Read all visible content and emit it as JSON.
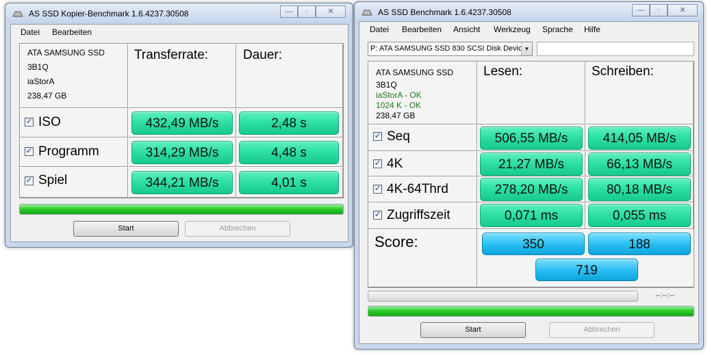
{
  "copy_window": {
    "title": "AS SSD Kopier-Benchmark 1.6.4237.30508",
    "menu": [
      "Datei",
      "Bearbeiten"
    ],
    "drive": {
      "model": "ATA SAMSUNG SSD",
      "firmware": "3B1Q",
      "driver": "iaStorA",
      "size": "238,47 GB"
    },
    "headers": {
      "rate": "Transferrate:",
      "duration": "Dauer:"
    },
    "rows": [
      {
        "label": "ISO",
        "rate": "432,49 MB/s",
        "duration": "2,48 s"
      },
      {
        "label": "Programm",
        "rate": "314,29 MB/s",
        "duration": "4,48 s"
      },
      {
        "label": "Spiel",
        "rate": "344,21 MB/s",
        "duration": "4,01 s"
      }
    ],
    "progress": 1.0,
    "start_label": "Start",
    "cancel_label": "Abbrechen"
  },
  "bench_window": {
    "title": "AS SSD Benchmark 1.6.4237.30508",
    "menu": [
      "Datei",
      "Bearbeiten",
      "Ansicht",
      "Werkzeug",
      "Sprache",
      "Hilfe"
    ],
    "drive_select": "P: ATA SAMSUNG SSD 830 SCSI Disk Device",
    "drive": {
      "model": "ATA SAMSUNG SSD",
      "firmware": "3B1Q",
      "driver_status": "iaStorA - OK",
      "align_status": "1024 K - OK",
      "size": "238,47 GB"
    },
    "headers": {
      "read": "Lesen:",
      "write": "Schreiben:"
    },
    "rows": [
      {
        "label": "Seq",
        "read": "506,55 MB/s",
        "write": "414,05 MB/s"
      },
      {
        "label": "4K",
        "read": "21,27 MB/s",
        "write": "66,13 MB/s"
      },
      {
        "label": "4K-64Thrd",
        "read": "278,20 MB/s",
        "write": "80,18 MB/s"
      },
      {
        "label": "Zugriffszeit",
        "read": "0,071 ms",
        "write": "0,055 ms"
      }
    ],
    "score": {
      "label": "Score:",
      "read": "350",
      "write": "188",
      "total": "719"
    },
    "time_text": "--:--:--",
    "progress_top": 0.0,
    "progress_bottom": 1.0,
    "start_label": "Start",
    "cancel_label": "Abbrechen"
  },
  "colors": {
    "value_bg": "#2ee0a6",
    "score_bg": "#2cc0f2",
    "progress": "#2fcd2f",
    "ok_text": "#1a7a1a"
  }
}
